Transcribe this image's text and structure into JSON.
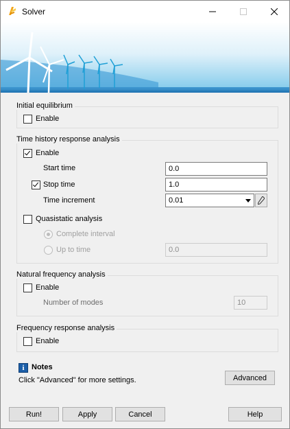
{
  "window": {
    "title": "Solver",
    "icon": "solver-wing-icon",
    "controls": [
      "minimize-icon",
      "maximize-icon",
      "close-icon"
    ]
  },
  "banner": {
    "image": "wind-turbines-banner",
    "colors": {
      "sky": "#6ec3e8",
      "sea": "#1b6fb0"
    }
  },
  "initial_equilibrium": {
    "title": "Initial equilibrium",
    "enable": {
      "label": "Enable",
      "checked": false
    }
  },
  "time_history": {
    "title": "Time history response analysis",
    "enable": {
      "label": "Enable",
      "checked": true
    },
    "start_time": {
      "label": "Start time",
      "value": "0.0"
    },
    "stop_time": {
      "label": "Stop time",
      "checked": true,
      "value": "1.0"
    },
    "time_increment": {
      "label": "Time increment",
      "value": "0.01"
    },
    "quasistatic": {
      "label": "Quasistatic analysis",
      "checked": false
    },
    "complete_interval": {
      "label": "Complete interval",
      "selected": true
    },
    "up_to_time": {
      "label": "Up to time",
      "selected": false,
      "value": "0.0"
    }
  },
  "natural_frequency": {
    "title": "Natural frequency analysis",
    "enable": {
      "label": "Enable",
      "checked": false
    },
    "number_of_modes": {
      "label": "Number of modes",
      "value": "10"
    }
  },
  "frequency_response": {
    "title": "Frequency response analysis",
    "enable": {
      "label": "Enable",
      "checked": false
    }
  },
  "notes": {
    "title": "Notes",
    "text": "Click \"Advanced\" for more settings.",
    "advanced_label": "Advanced"
  },
  "footer": {
    "run_label": "Run!",
    "apply_label": "Apply",
    "cancel_label": "Cancel",
    "help_label": "Help"
  }
}
